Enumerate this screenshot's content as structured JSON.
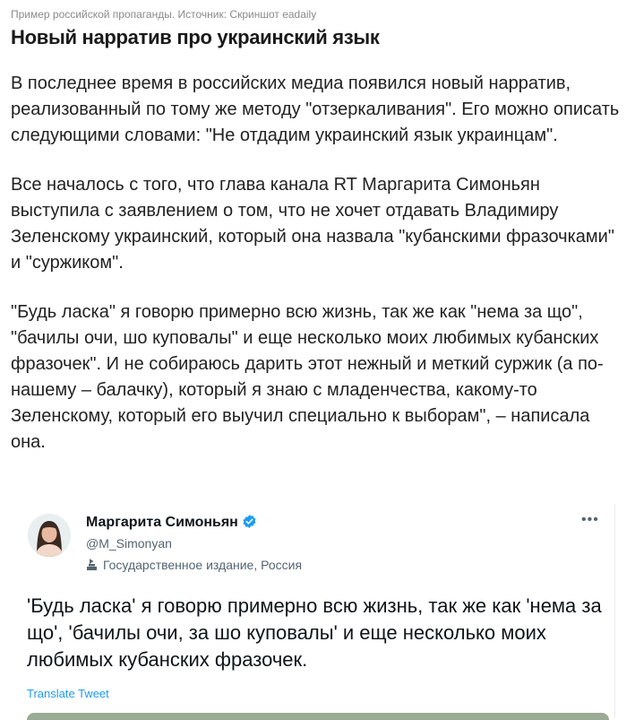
{
  "article": {
    "caption": "Пример российской пропаганды. Источник: Скриншот eadaily",
    "title": "Новый нарратив про украинский язык",
    "paragraphs": [
      "В последнее время в российских медиа появился новый нарратив, реализованный по тому же методу \"отзеркаливания\". Его можно описать следующими словами: \"Не отдадим украинский язык украинцам\".",
      "Все началось с того, что глава канала RT Маргарита Симоньян выступила с заявлением о том, что не хочет отдавать Владимиру Зеленскому украинский, который она назвала \"кубанскими фразочками\" и \"суржиком\".",
      "\"Будь ласка\" я говорю примерно всю жизнь, так же как \"нема за що\", \"бачилы очи, шо куповалы\" и еще несколько моих любимых кубанских фразочек\". И не собираюсь дарить этот нежный и меткий суржик (а по-нашему – балачку), который я знаю с младенчества, какому-то Зеленскому, который его выучил специально к выборам\", – написала она."
    ]
  },
  "tweet": {
    "author_name": "Маргарита Симоньян",
    "handle": "@M_Simonyan",
    "account_label": "Государственное издание, Россия",
    "text": "'Будь ласка' я говорю примерно всю жизнь, так же как 'нема за що', 'бачилы очи, за шо куповалы' и еще несколько моих любимых кубанских фразочек.",
    "translate_label": "Translate Tweet",
    "more_label": "•••",
    "icons": {
      "verified": "verified-badge-icon",
      "label": "state-media-flag-icon",
      "more": "more-options-icon",
      "avatar": "avatar"
    },
    "colors": {
      "link": "#1d9bf0",
      "secondary_text": "#536471",
      "verified": "#1d9bf0"
    }
  }
}
